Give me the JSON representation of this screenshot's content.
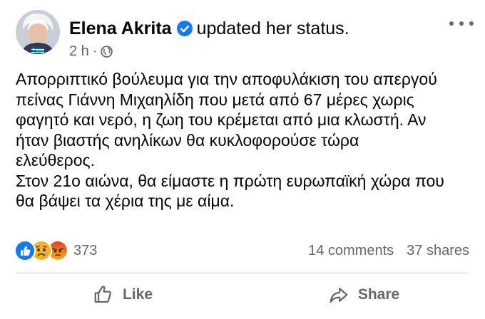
{
  "post": {
    "author": "Elena Akrita",
    "action": "updated her status.",
    "time": "2 h",
    "separator": "·",
    "text_lines": [
      "Απορριπτικό βούλευμα για την αποφυλάκιση του απεργού",
      "πείνας Γιάννη Μιχαηλίδη που μετά από 67 μέρες χωρις",
      "φαγητό και νερό, η ζωη του κρέμεται από μια κλωστή. Αν",
      "ήταν βιαστής ανηλίκων θα κυκλοφορούσε τώρα",
      "ελεύθερος.",
      "Στον 21ο αιώνα, θα είμαστε η πρώτη ευρωπαϊκή χώρα που",
      "θα βάψει τα χέρια της με αίμα."
    ]
  },
  "reactions": {
    "types": [
      "like",
      "sad",
      "angry"
    ],
    "count": "373"
  },
  "stats": {
    "comments": "14 comments",
    "shares": "37 shares"
  },
  "actions": {
    "like": "Like",
    "share": "Share"
  },
  "icons": {
    "verified": "verified-badge-icon",
    "audience": "globe-icon",
    "more": "more-options-icon"
  },
  "colors": {
    "text": "#050505",
    "secondary": "#65676b",
    "verified": "#1877f2",
    "like_reaction": "#1877f2",
    "sad_reaction": "#f7b125",
    "angry_reaction": "#e9710f"
  }
}
